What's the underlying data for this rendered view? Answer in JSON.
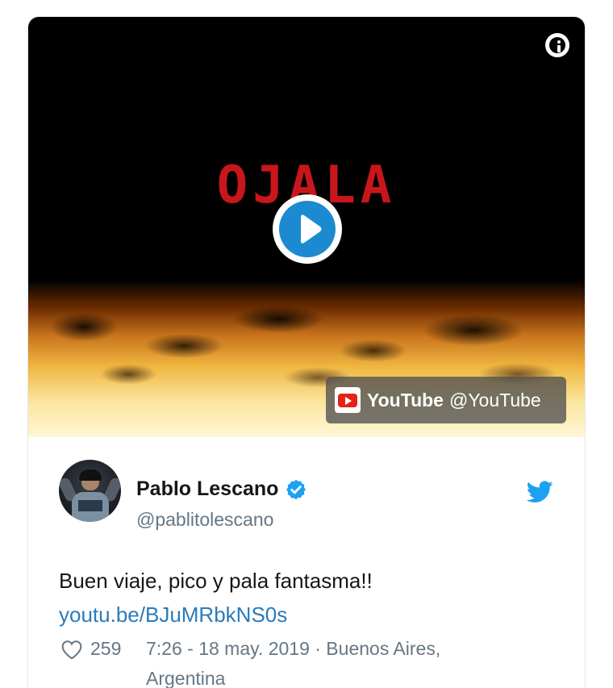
{
  "media": {
    "video_title_text": "OJALA",
    "source_name": "YouTube",
    "source_handle": "@YouTube",
    "icons": {
      "info": "info-icon",
      "play": "play-icon",
      "source_logo": "youtube-logo-icon"
    }
  },
  "tweet": {
    "author_name": "Pablo Lescano",
    "author_handle": "@pablitolescano",
    "verified": true,
    "text": "Buen viaje, pico y pala fantasma!!",
    "link": "youtu.be/BJuMRbkNS0s",
    "likes": "259",
    "timestamp_location": "7:26 - 18 may. 2019 · Buenos Aires, Argentina",
    "icons": {
      "verified": "verified-badge-icon",
      "brand": "twitter-bird-icon",
      "like": "heart-icon"
    }
  },
  "colors": {
    "link": "#2b7bb9",
    "secondary_text": "#657786",
    "twitter_blue": "#1da1f2",
    "play_blue": "#1c8ad0",
    "video_title_red": "#c8161c",
    "youtube_red": "#e62117"
  }
}
